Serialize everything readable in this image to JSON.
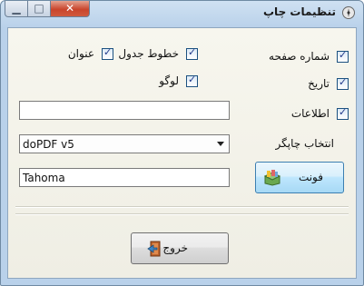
{
  "window": {
    "title": "تنظیمات چاپ"
  },
  "options": {
    "page_number_label": "شماره صفحه",
    "date_label": "تاریخ",
    "info_label": "اطلاعات",
    "table_lines_label": "خطوط جدول",
    "title_label": "عنوان",
    "logo_label": "لوگو",
    "printer_select_label": "انتخاب چاپگر"
  },
  "fields": {
    "text_value": "",
    "printer_value": "doPDF v5",
    "font_value": "Tahoma"
  },
  "buttons": {
    "font_label": "فونت",
    "exit_label": "خروج"
  }
}
